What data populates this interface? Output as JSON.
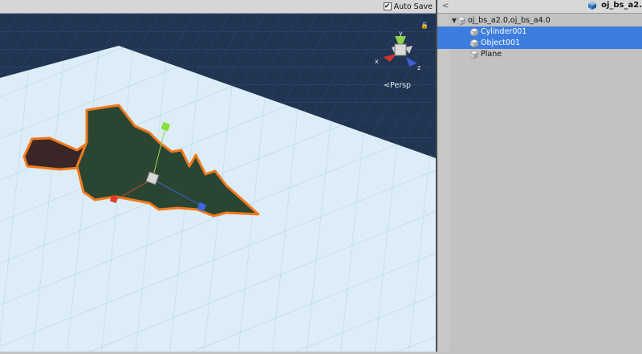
{
  "toolbar": {
    "autosave_label": "Auto Save",
    "autosave_checked": true,
    "check_glyph": "✔"
  },
  "scene_view": {
    "projection_label": "Persp",
    "projection_arrow": "⋖",
    "gizmo_axes": {
      "x": "x",
      "y": "y",
      "z": "z"
    },
    "lock_icon": "lock-icon",
    "colors": {
      "background": "#213553",
      "plane": "#dcedf8",
      "outline": "#f07a1e",
      "mesh": "#2a4632"
    }
  },
  "hierarchy": {
    "back_glyph": "<",
    "scene_name": "oj_bs_a2.",
    "items": [
      {
        "label": "oj_bs_a2.0,oj_bs_a4.0",
        "expanded": true,
        "selected": false,
        "depth": 0
      },
      {
        "label": "Cylinder001",
        "selected": true,
        "depth": 1
      },
      {
        "label": "Object001",
        "selected": true,
        "depth": 1
      },
      {
        "label": "Plane",
        "selected": false,
        "depth": 1
      }
    ],
    "selection_color": "#3e7de0"
  }
}
